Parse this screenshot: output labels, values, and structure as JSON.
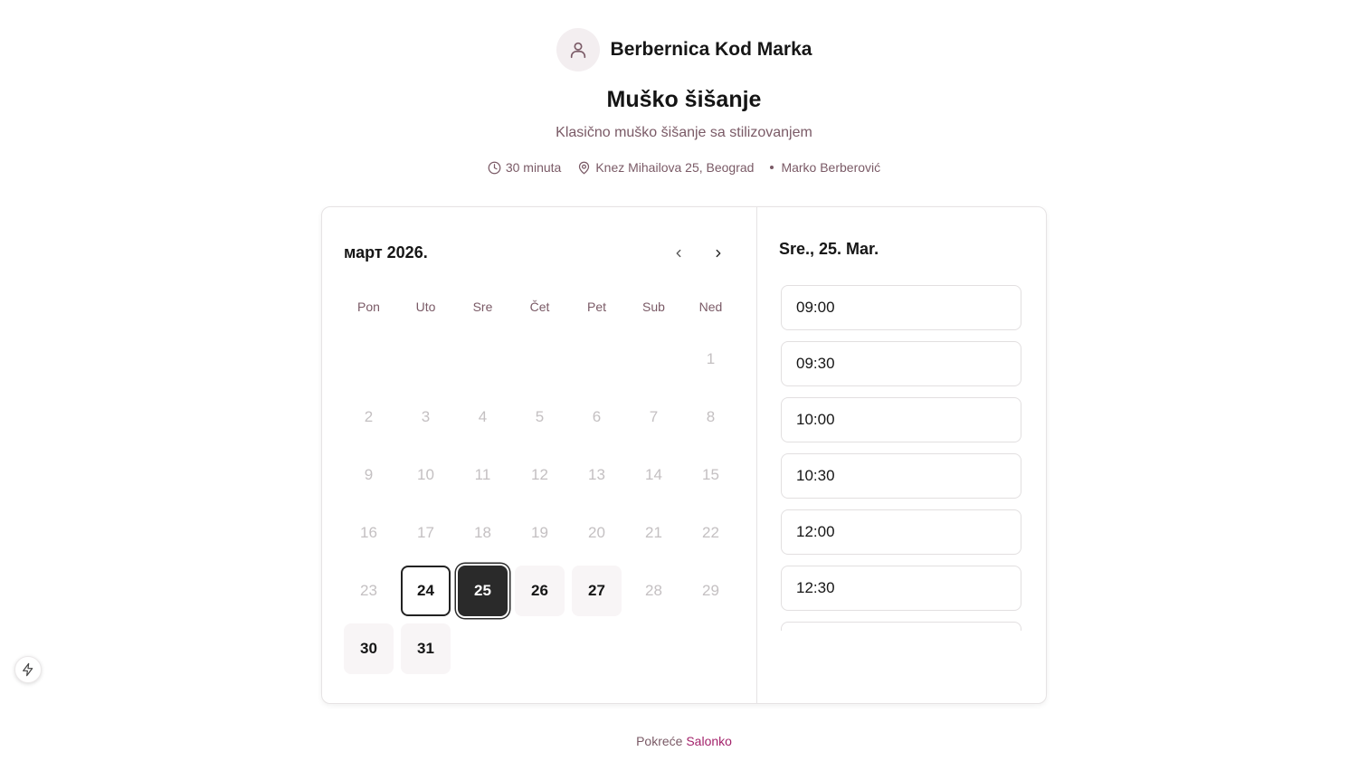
{
  "business": {
    "name": "Berbernica Kod Marka",
    "avatar_icon": "user-icon"
  },
  "service": {
    "title": "Muško šišanje",
    "description": "Klasično muško šišanje sa stilizovanjem",
    "duration": "30 minuta",
    "address": "Knez Mihailova 25, Beograd",
    "staff": "Marko Berberović"
  },
  "calendar": {
    "month_label": "март 2026.",
    "weekdays": [
      "Pon",
      "Uto",
      "Sre",
      "Čet",
      "Pet",
      "Sub",
      "Ned"
    ],
    "leading_blanks": 6,
    "days": [
      {
        "n": "1",
        "state": "disabled"
      },
      {
        "n": "2",
        "state": "disabled"
      },
      {
        "n": "3",
        "state": "disabled"
      },
      {
        "n": "4",
        "state": "disabled"
      },
      {
        "n": "5",
        "state": "disabled"
      },
      {
        "n": "6",
        "state": "disabled"
      },
      {
        "n": "7",
        "state": "disabled"
      },
      {
        "n": "8",
        "state": "disabled"
      },
      {
        "n": "9",
        "state": "disabled"
      },
      {
        "n": "10",
        "state": "disabled"
      },
      {
        "n": "11",
        "state": "disabled"
      },
      {
        "n": "12",
        "state": "disabled"
      },
      {
        "n": "13",
        "state": "disabled"
      },
      {
        "n": "14",
        "state": "disabled"
      },
      {
        "n": "15",
        "state": "disabled"
      },
      {
        "n": "16",
        "state": "disabled"
      },
      {
        "n": "17",
        "state": "disabled"
      },
      {
        "n": "18",
        "state": "disabled"
      },
      {
        "n": "19",
        "state": "disabled"
      },
      {
        "n": "20",
        "state": "disabled"
      },
      {
        "n": "21",
        "state": "disabled"
      },
      {
        "n": "22",
        "state": "disabled"
      },
      {
        "n": "23",
        "state": "disabled"
      },
      {
        "n": "24",
        "state": "today"
      },
      {
        "n": "25",
        "state": "selected"
      },
      {
        "n": "26",
        "state": "available"
      },
      {
        "n": "27",
        "state": "available"
      },
      {
        "n": "28",
        "state": "disabled"
      },
      {
        "n": "29",
        "state": "disabled"
      },
      {
        "n": "30",
        "state": "available"
      },
      {
        "n": "31",
        "state": "available"
      }
    ]
  },
  "slots": {
    "date_label": "Sre., 25. Mar.",
    "times": [
      "09:00",
      "09:30",
      "10:00",
      "10:30",
      "12:00",
      "12:30",
      ""
    ]
  },
  "footer": {
    "prefix": "Pokreće",
    "brand": "Salonko",
    "brand_color": "#a3236b"
  },
  "icons": {
    "duration": "clock-icon",
    "address": "map-pin-icon",
    "prev": "chevron-left-icon",
    "next": "chevron-right-icon",
    "floating": "lightning-icon"
  }
}
